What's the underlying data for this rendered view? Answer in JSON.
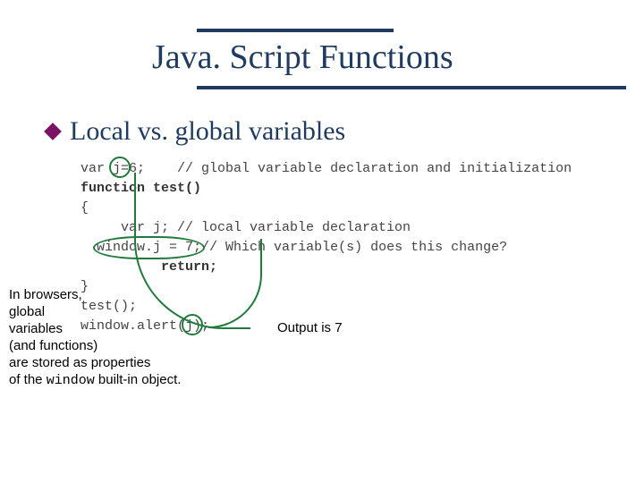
{
  "title": "Java. Script Functions",
  "heading": "Local vs. global variables",
  "code": {
    "l1a": "var ",
    "l1_j": "j",
    "l1b": "=6;    // global variable declaration and initialization",
    "l2": "function test()",
    "l3": "{",
    "l4": "     var j; // local variable declaration",
    "l5a": "  ",
    "l5_box": "window.j = 7;",
    "l5b": "// Which variable(s) does this change?",
    "l6": "          return;",
    "l7": "}",
    "l8": "test();",
    "l9a": "window.alert(",
    "l9_j": "j",
    "l9b": ");"
  },
  "note_left": {
    "line1": "In browsers,",
    "line2": "global",
    "line3": "variables",
    "line4": "(and functions)",
    "line5": "are stored as properties",
    "line6a": "of the ",
    "line6_mono": "window",
    "line6b": " built-in object."
  },
  "note_output": "Output is 7"
}
